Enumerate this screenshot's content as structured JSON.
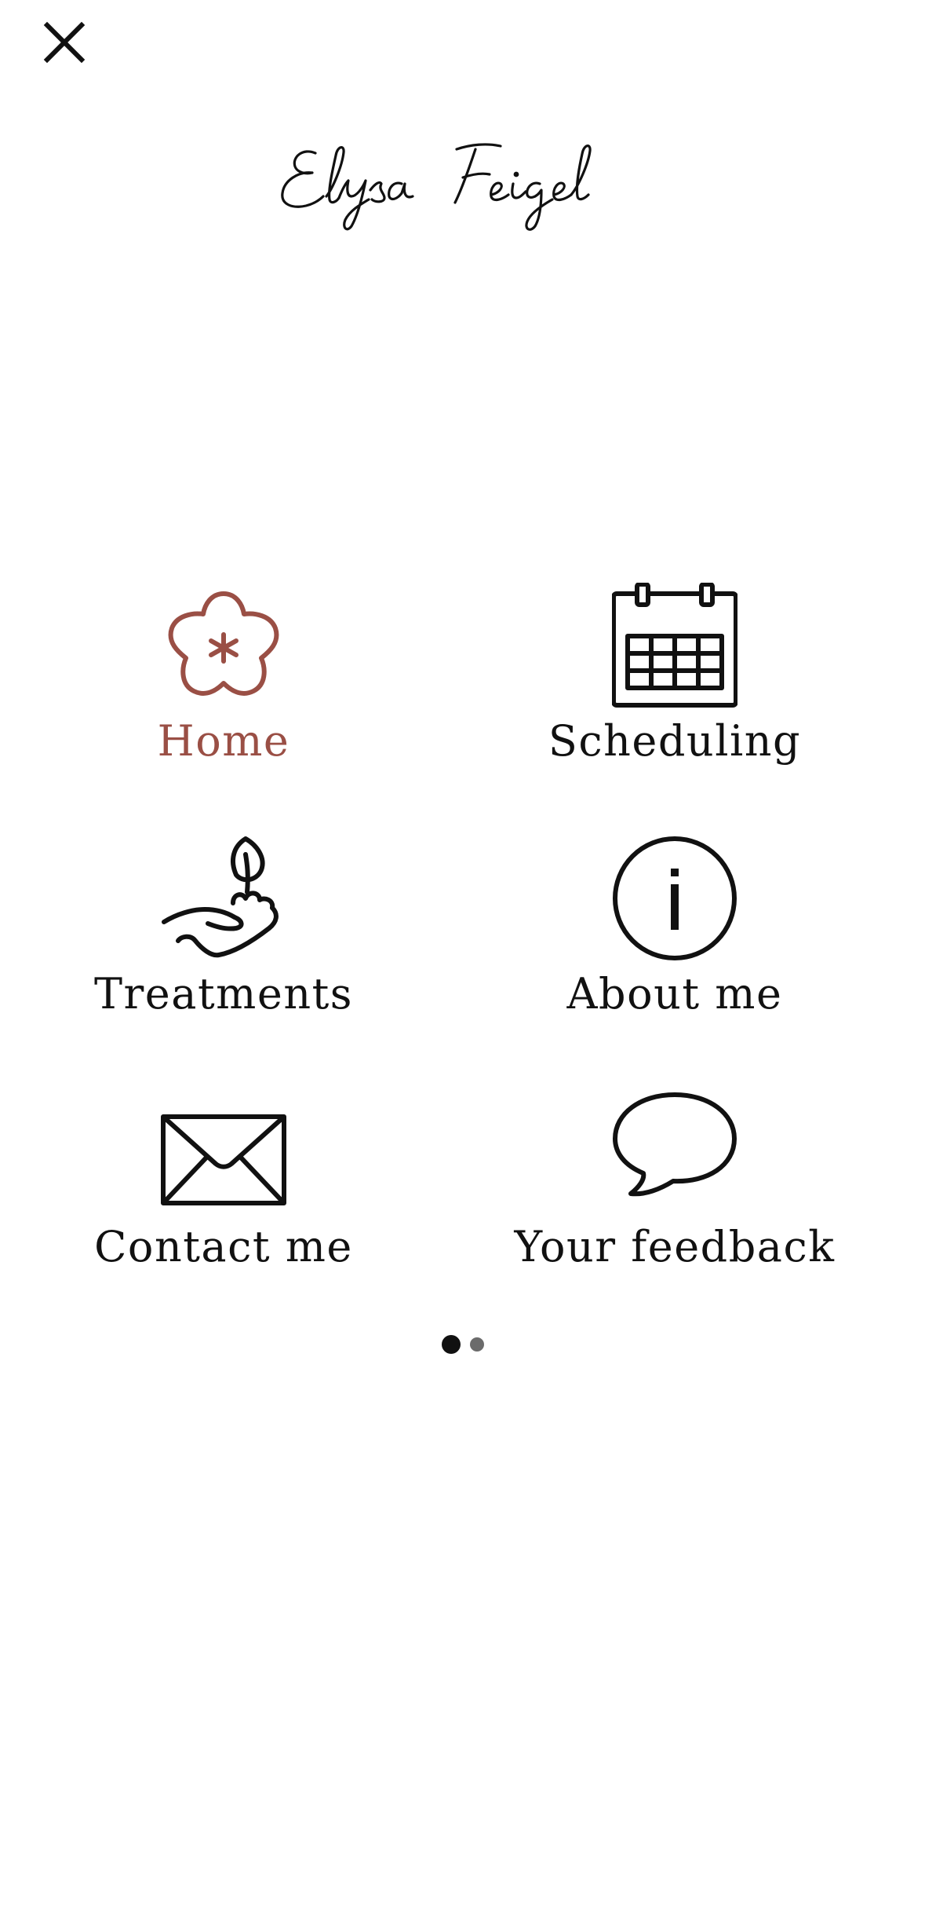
{
  "brand": {
    "name": "Elysa Feigel"
  },
  "colors": {
    "accent": "#9a4f45",
    "text": "#111111",
    "background": "#ffffff",
    "dot_inactive": "#6b6b6b"
  },
  "menu": {
    "items": [
      {
        "label": "Home",
        "icon": "flower-icon",
        "active": true
      },
      {
        "label": "Scheduling",
        "icon": "calendar-icon",
        "active": false
      },
      {
        "label": "Treatments",
        "icon": "hand-sprout-icon",
        "active": false
      },
      {
        "label": "About me",
        "icon": "info-icon",
        "active": false
      },
      {
        "label": "Contact me",
        "icon": "envelope-icon",
        "active": false
      },
      {
        "label": "Your feedback",
        "icon": "speech-bubble-icon",
        "active": false
      }
    ]
  },
  "pager": {
    "pages": 2,
    "current": 1
  }
}
